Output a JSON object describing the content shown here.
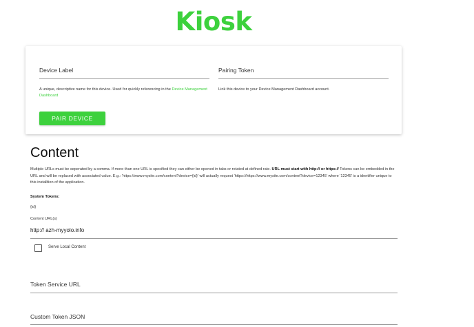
{
  "app": {
    "logo_text": "Kiosk",
    "accent_color": "#3dd13d"
  },
  "pairing": {
    "device_label": {
      "label": "Device Label",
      "value": ""
    },
    "device_label_helper": "A unique, descriptive name for this device. Used for quickly referencing in the ",
    "device_label_helper_link": "Device Management Dashboard",
    "pairing_token": {
      "label": "Pairing Token",
      "value": ""
    },
    "pairing_token_helper": "Link this device to your Device Management Dashboard account.",
    "pair_button": "PAIR DEVICE"
  },
  "content": {
    "title": "Content",
    "description_part1": "Multiple URLs must be seperated by a comma. If more than one URL is specified they can either be opened in tabs or rotated at defined rate. ",
    "description_bold": "URL must start with http:// or https://",
    "description_part2": " Tokens can be embedded in the URL and will be replaced with associated value. E.g.: 'https://www.mysite.com/content?device={id}' will actually request 'https://https://www.mysite.com/content?device=12345' where '12345' is a identifier unique to this installtion of the application.",
    "system_tokens_label": "System Tokens:",
    "system_tokens_value": "{id}",
    "content_urls_label": "Content URL(s)",
    "content_urls_value": "http:// azh-myyolo.info",
    "serve_local": {
      "label": "Serve Local Content",
      "checked": false
    },
    "token_service_url": {
      "label": "Token Service URL",
      "value": ""
    },
    "custom_token_json": {
      "label": "Custom Token JSON",
      "value": ""
    }
  }
}
